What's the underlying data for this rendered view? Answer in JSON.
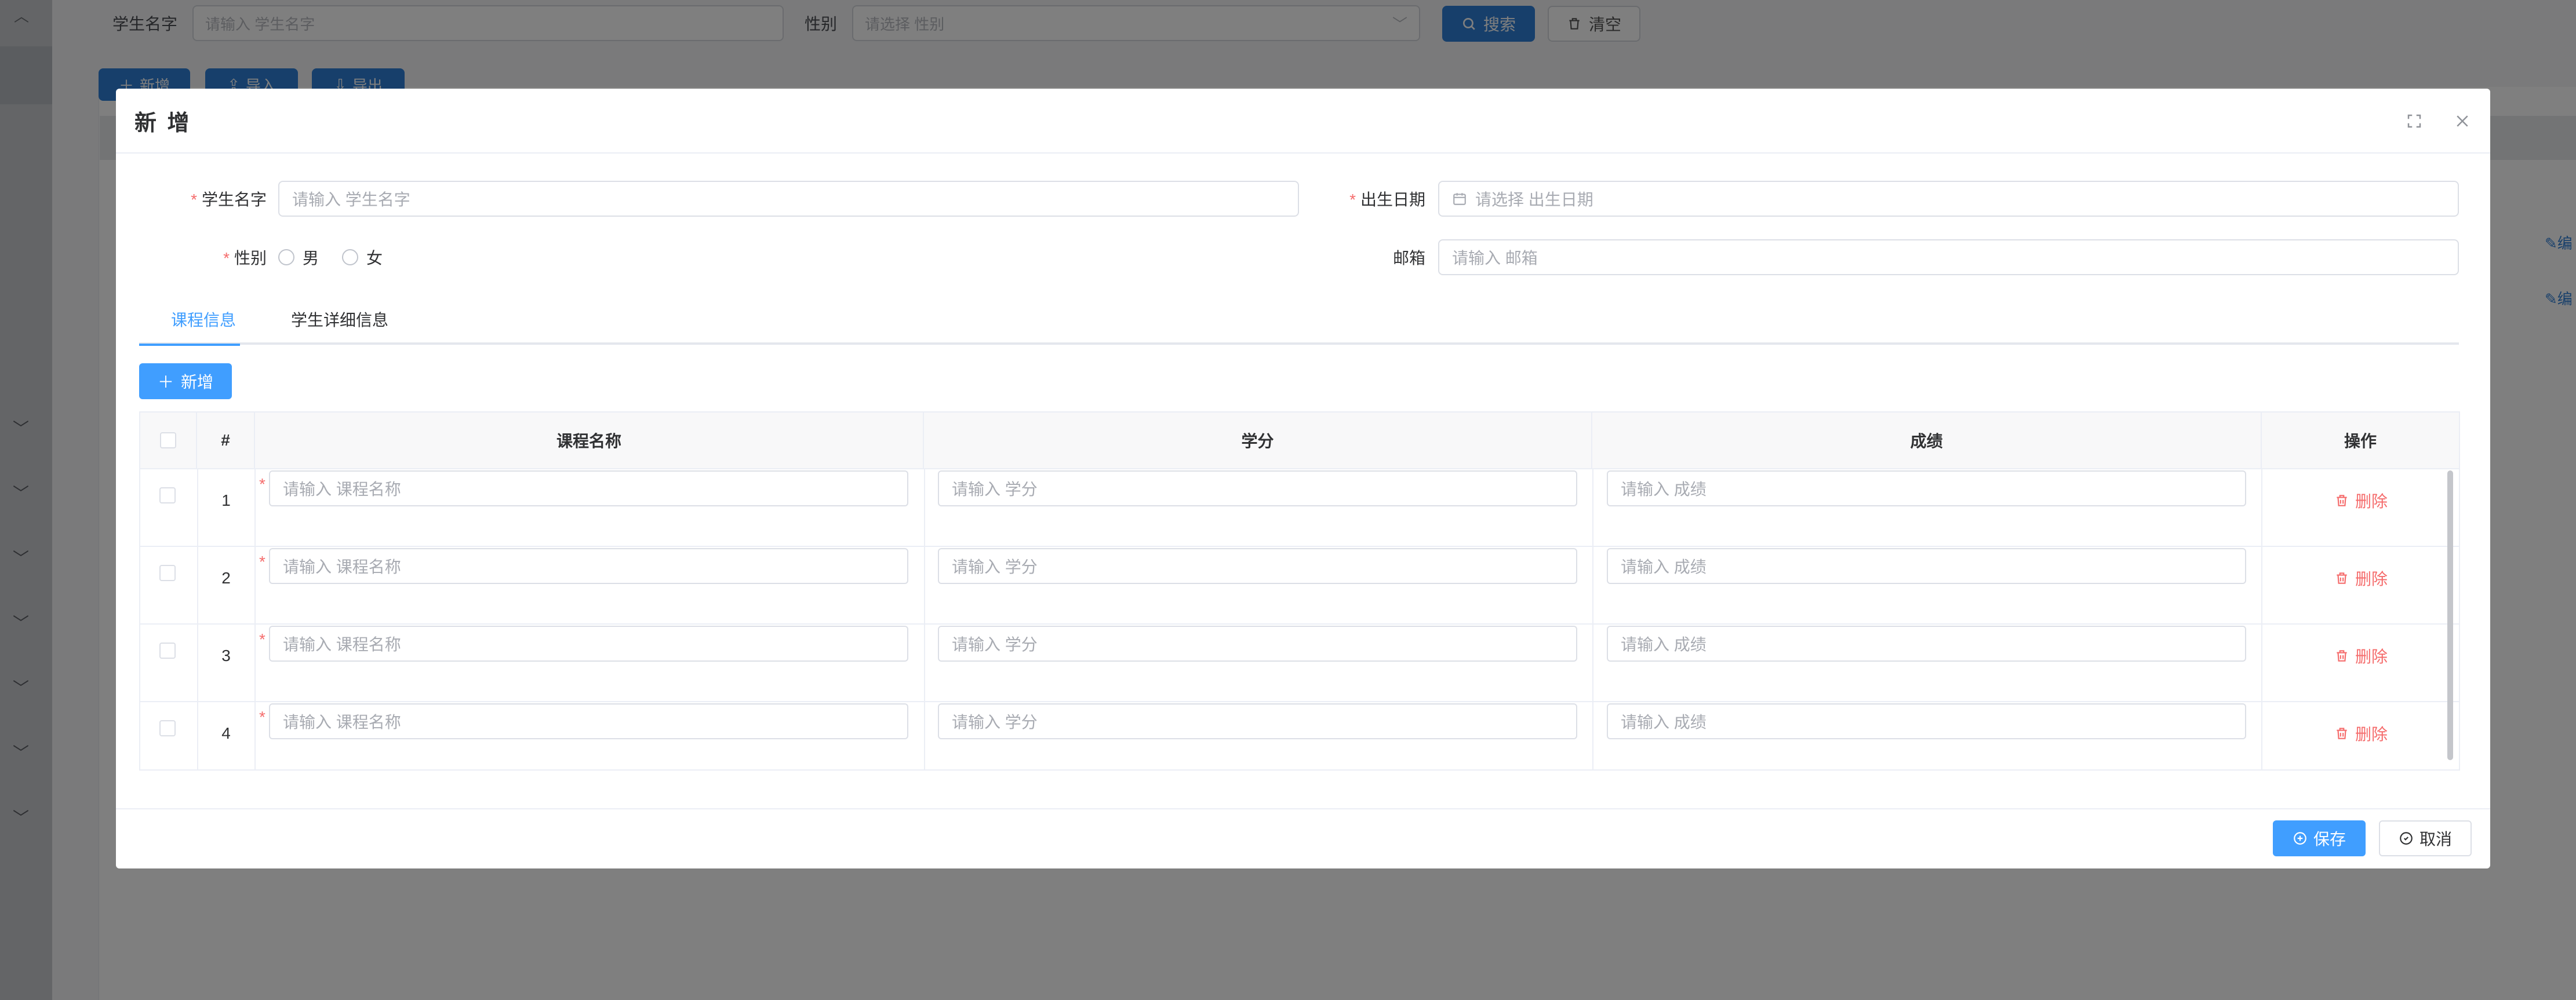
{
  "background": {
    "search": {
      "student_name_label": "学生名字",
      "student_name_placeholder": "请输入 学生名字",
      "gender_label": "性别",
      "gender_placeholder": "请选择 性别",
      "search_button": "搜索",
      "clear_button": "清空"
    },
    "toolbar": {
      "add_button": "新增",
      "import_button": "导入",
      "export_button": "导出"
    },
    "row_actions": {
      "edit_label": "编"
    }
  },
  "modal": {
    "title": "新 增",
    "form": {
      "student_name": {
        "label": "学生名字",
        "placeholder": "请输入 学生名字"
      },
      "birth_date": {
        "label": "出生日期",
        "placeholder": "请选择 出生日期"
      },
      "gender": {
        "label": "性别",
        "options": [
          "男",
          "女"
        ]
      },
      "email": {
        "label": "邮箱",
        "placeholder": "请输入 邮箱"
      }
    },
    "tabs": [
      {
        "label": "课程信息",
        "active": true
      },
      {
        "label": "学生详细信息",
        "active": false
      }
    ],
    "add_button": "新增",
    "table": {
      "columns": [
        "#",
        "课程名称",
        "学分",
        "成绩",
        "操作"
      ],
      "rows": [
        {
          "index": "1",
          "course_placeholder": "请输入 课程名称",
          "credit_placeholder": "请输入 学分",
          "score_placeholder": "请输入 成绩",
          "action": "删除"
        },
        {
          "index": "2",
          "course_placeholder": "请输入 课程名称",
          "credit_placeholder": "请输入 学分",
          "score_placeholder": "请输入 成绩",
          "action": "删除"
        },
        {
          "index": "3",
          "course_placeholder": "请输入 课程名称",
          "credit_placeholder": "请输入 学分",
          "score_placeholder": "请输入 成绩",
          "action": "删除"
        },
        {
          "index": "4",
          "course_placeholder": "请输入 课程名称",
          "credit_placeholder": "请输入 学分",
          "score_placeholder": "请输入 成绩",
          "action": "删除"
        }
      ]
    },
    "footer": {
      "save_button": "保存",
      "cancel_button": "取消"
    }
  },
  "colors": {
    "primary": "#409eff",
    "danger": "#f56c6c",
    "overlay": "rgba(0,0,0,0.5)"
  },
  "icons": [
    "chevron-up-icon",
    "chevron-down-icon",
    "search-icon",
    "trash-icon",
    "plus-icon",
    "upload-icon",
    "download-icon",
    "calendar-icon",
    "fullscreen-icon",
    "close-icon",
    "save-icon",
    "cancel-icon",
    "edit-icon"
  ]
}
